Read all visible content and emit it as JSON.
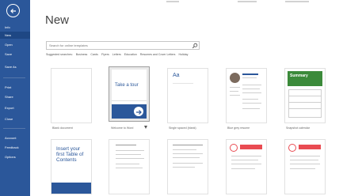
{
  "sidebar": {
    "items": [
      {
        "label": "Info"
      },
      {
        "label": "New"
      },
      {
        "label": "Open"
      },
      {
        "label": "Save"
      },
      {
        "label": "Save As"
      },
      {
        "label": "Print"
      },
      {
        "label": "Share"
      },
      {
        "label": "Export"
      },
      {
        "label": "Close"
      },
      {
        "label": "Account"
      },
      {
        "label": "Feedback"
      },
      {
        "label": "Options"
      }
    ]
  },
  "main": {
    "title": "New",
    "search_placeholder": "Search for online templates",
    "suggested_label": "Suggested searches:",
    "suggested": [
      "Business",
      "Cards",
      "Flyers",
      "Letters",
      "Education",
      "Resumes and Cover Letters",
      "Holiday"
    ]
  },
  "templates": [
    {
      "caption": "Blank document"
    },
    {
      "caption": "Welcome to Word",
      "title_text": "Take a tour"
    },
    {
      "caption": "Single spaced (blank)",
      "title_text": "Aa"
    },
    {
      "caption": "Blue grey resume"
    },
    {
      "caption": "Snapshot calendar",
      "title_text": "Summary"
    },
    {
      "caption": "",
      "title_text": "Insert your first Table of Contents"
    },
    {
      "caption": ""
    },
    {
      "caption": ""
    },
    {
      "caption": ""
    },
    {
      "caption": ""
    }
  ]
}
